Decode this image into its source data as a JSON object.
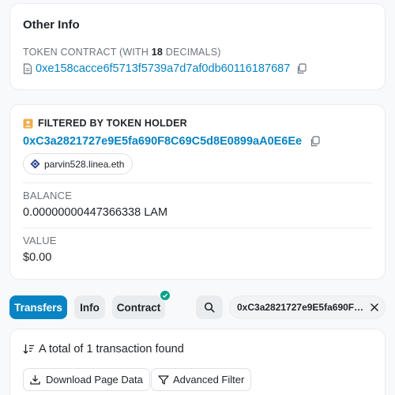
{
  "other_info": {
    "title": "Other Info",
    "token_contract_label": "TOKEN CONTRACT (WITH",
    "decimals": "18",
    "decimals_suffix": "DECIMALS)",
    "contract_address": "0xe158cacce6f5713f5739a7d7af0db60116187687",
    "doc_icon": "document-icon",
    "copy_icon": "copy-icon"
  },
  "filter": {
    "heading": "FILTERED BY TOKEN HOLDER",
    "holder_icon": "id-card-icon",
    "holder_address": "0xC3a2821727e9E5fa690F8C69C5d8E0899aA0E6Ee",
    "ens_name": "parvin528.linea.eth",
    "ens_icon": "linea-diamond-icon",
    "balance_label": "BALANCE",
    "balance_value": "0.00000000447366338 LAM",
    "value_label": "VALUE",
    "value_amount": "$0.00"
  },
  "tabs": {
    "transfers": "Transfers",
    "info": "Info",
    "contract": "Contract",
    "contract_badge_icon": "check-icon",
    "search_icon": "search-icon",
    "filter_text": "0xC3a2821727e9E5fa690F8C...",
    "clear_icon": "close-icon"
  },
  "transactions": {
    "summary": "A total of 1 transaction found",
    "sort_icon": "sort-icon",
    "download_label": "Download Page Data",
    "download_icon": "download-icon",
    "advanced_filter_label": "Advanced Filter",
    "filter_icon": "funnel-icon"
  },
  "colors": {
    "link": "#0784c3",
    "primary": "#0784c3",
    "badge": "#00a186",
    "muted": "#6c757d"
  }
}
